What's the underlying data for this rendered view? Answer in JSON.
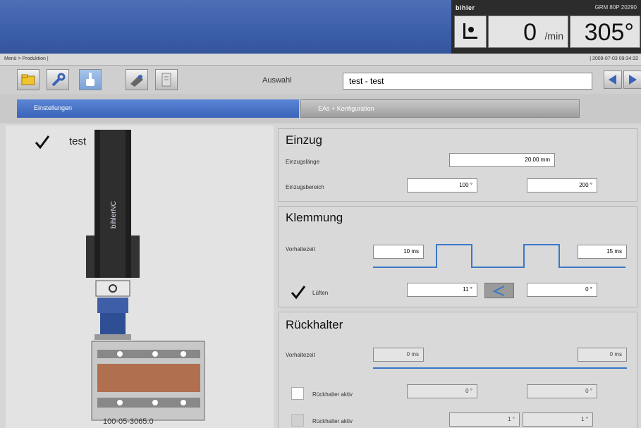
{
  "status": {
    "brand": "bihler",
    "brand_right": "GRM 80P 20290",
    "count": "0",
    "count_unit": "/min",
    "angle": "305°"
  },
  "breadcrumb": {
    "path": "Menü > Produktion |",
    "timestamp": "| 2009-07-03 09:34:32"
  },
  "toolbar": {
    "icons": [
      "folder-icon",
      "wrench-icon",
      "hand-icon",
      "tool-icon",
      "document-icon"
    ],
    "selection_label": "Auswahl",
    "selection_value": "test - test"
  },
  "tabs": {
    "settings": "Einstellungen",
    "config": "EAs + Konfiguration"
  },
  "left": {
    "item_label": "test",
    "part_number": "100-05-3065.0",
    "device_brand": "bihlerNC"
  },
  "einzug": {
    "title": "Einzug",
    "length_label": "Einzugslänge",
    "length_value": "20.00 mm",
    "range_label": "Einzugsbereich",
    "range_from": "100 °",
    "range_to": "200 °"
  },
  "klemmung": {
    "title": "Klemmung",
    "delay_label": "Vorhaltezeit",
    "delay_left": "10 ms",
    "delay_right": "15 ms",
    "lueften_label": "Lüften",
    "lueften_from": "11 °",
    "lueften_to": "0 °"
  },
  "rueckhalter": {
    "title": "Rückhalter",
    "delay_label": "Vorhaltezeit",
    "delay_left": "0 ms",
    "delay_right": "0 ms",
    "active1_label": "Rückhalter aktiv",
    "active1_from": "0 °",
    "active1_to": "0 °",
    "active2_label": "Rückhalter aktiv",
    "active2_from": "1 °",
    "active2_to": "1 °"
  },
  "colors": {
    "banner": "#3b5ea8",
    "tab_active": "#3a64b8",
    "signal_line": "#3a78c8"
  }
}
